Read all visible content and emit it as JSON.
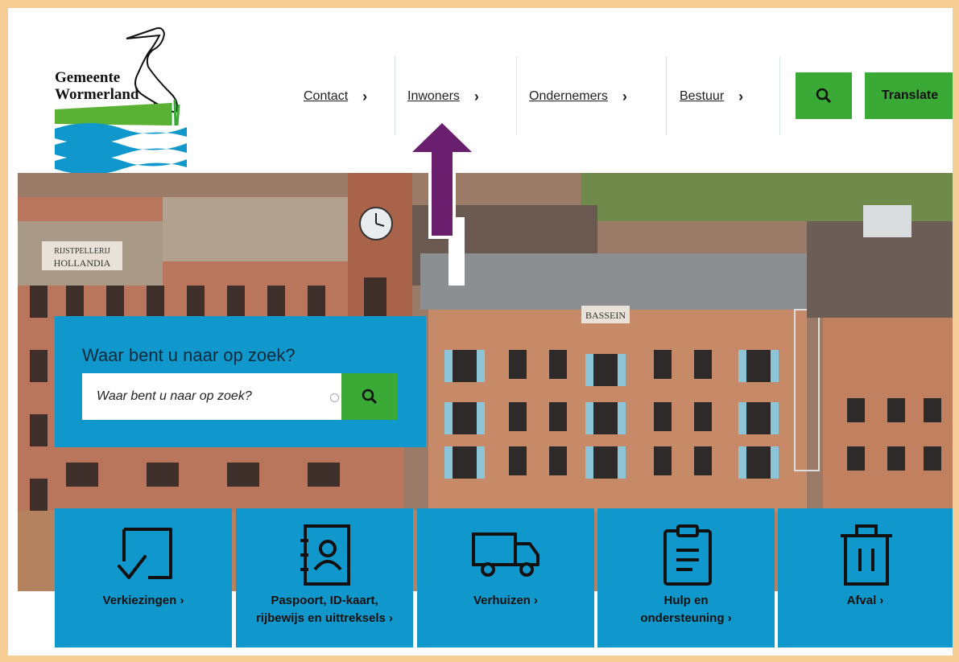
{
  "header": {
    "logo_line1": "Gemeente",
    "logo_line2": "Wormerland",
    "nav": [
      {
        "label": "Contact"
      },
      {
        "label": "Inwoners"
      },
      {
        "label": "Ondernemers"
      },
      {
        "label": "Bestuur"
      }
    ],
    "translate_label": "Translate",
    "search_icon": "search-icon"
  },
  "hero": {
    "search_title": "Waar bent u naar op zoek?",
    "search_placeholder": "Waar bent u naar op zoek?",
    "sign_left": "RIJSTPELLERIJ HOLLANDIA",
    "sign_center": "BASSEIN"
  },
  "tiles": [
    {
      "label": "Verkiezingen",
      "icon": "checkbox-icon"
    },
    {
      "label": "Paspoort, ID-kaart, rijbewijs en uittreksels",
      "icon": "contact-card-icon"
    },
    {
      "label": "Verhuizen",
      "icon": "truck-icon"
    },
    {
      "label": "Hulp en ondersteuning",
      "icon": "clipboard-icon"
    },
    {
      "label": "Afval",
      "icon": "trash-icon"
    }
  ],
  "colors": {
    "accent_blue": "#1098cc",
    "accent_green": "#3aa935",
    "arrow": "#6a1f6e"
  }
}
